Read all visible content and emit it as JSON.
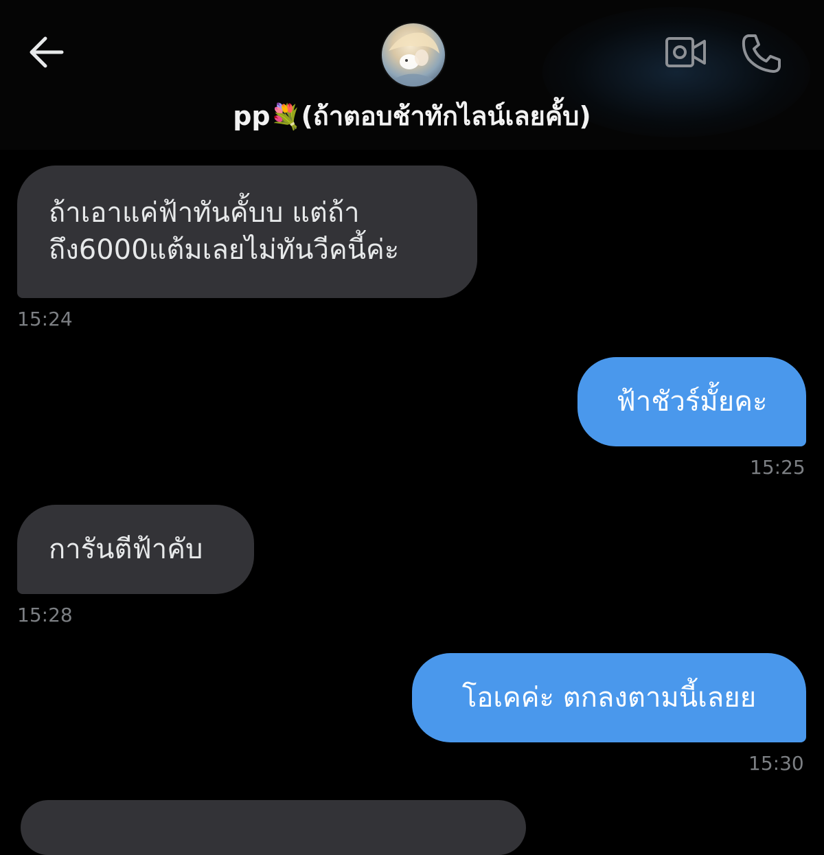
{
  "header": {
    "title_name": "pp",
    "title_emoji": "💐",
    "title_note": "(ถ้าตอบช้าทักไลน์เลยคั้บ)",
    "back_icon": "arrow-left-icon",
    "video_icon": "video-camera-icon",
    "call_icon": "phone-icon"
  },
  "messages": [
    {
      "direction": "in",
      "lines": [
        "ถ้าเอาแค่ฟ้าทันคั้บบ แต่ถ้า",
        "ถึง6000แต้มเลยไม่ทันวีคนี้ค่ะ"
      ],
      "time": "15:24"
    },
    {
      "direction": "out",
      "lines": [
        "ฟ้าชัวร์มั้ยคะ"
      ],
      "time": "15:25"
    },
    {
      "direction": "in",
      "lines": [
        "การันตีฟ้าคับ"
      ],
      "time": "15:28"
    },
    {
      "direction": "out",
      "lines": [
        "โอเคค่ะ ตกลงตามนี้เลยย"
      ],
      "time": "15:30"
    }
  ],
  "colors": {
    "incoming_bubble": "#333337",
    "outgoing_bubble": "#4a98ec",
    "timestamp": "#7c7f83",
    "background": "#000000"
  }
}
